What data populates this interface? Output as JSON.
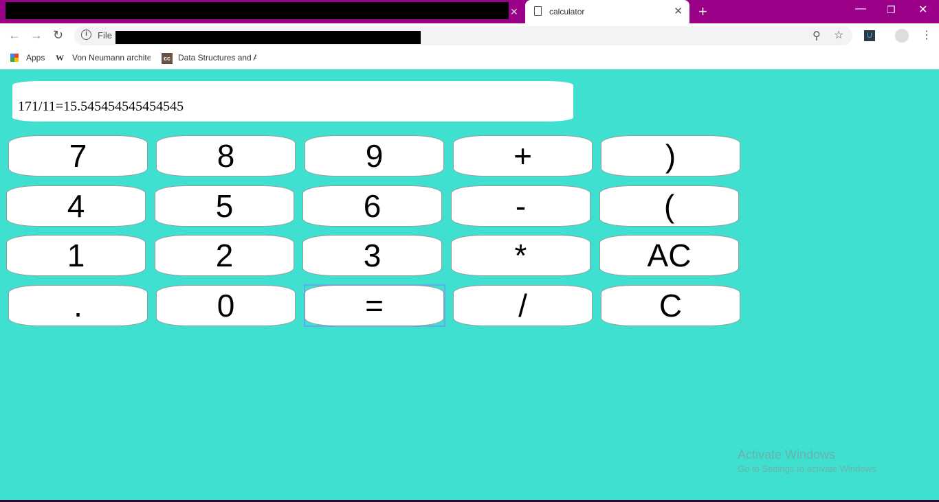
{
  "browser": {
    "active_tab_title": "calculator",
    "address_prefix": "File",
    "bookmarks": [
      {
        "label": "Apps"
      },
      {
        "label": "Von Neumann archite"
      },
      {
        "label": "Data Structures and A"
      }
    ]
  },
  "calculator": {
    "display": "171/11=15.545454545454545",
    "rows": [
      [
        "7",
        "8",
        "9",
        "+",
        ")"
      ],
      [
        "4",
        "5",
        "6",
        "-",
        "("
      ],
      [
        "1",
        "2",
        "3",
        "*",
        "AC"
      ],
      [
        ".",
        "0",
        "=",
        "/",
        "C"
      ]
    ]
  },
  "watermark": {
    "title": "Activate Windows",
    "subtitle": "Go to Settings to activate Windows."
  },
  "colors": {
    "page_bg": "#40e0d0",
    "titlebar": "#9b0088",
    "focus": "#5aaeea"
  }
}
